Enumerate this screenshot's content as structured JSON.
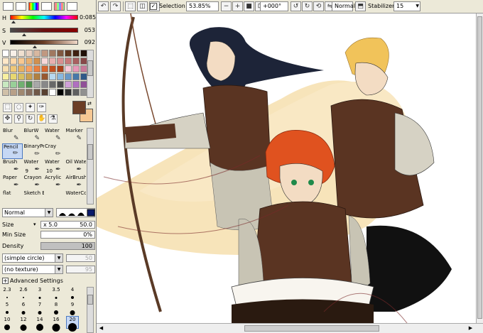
{
  "color_panel": {
    "h": {
      "label": "H",
      "value": "0:085",
      "fraction": 0.05
    },
    "s": {
      "label": "S",
      "value": "053",
      "fraction": 0.21
    },
    "v": {
      "label": "V",
      "value": "092",
      "fraction": 0.36
    },
    "main_color": "#6b3e26",
    "sub_color": "#f6c893"
  },
  "swatches": [
    "#ffffff",
    "#f8f0e8",
    "#f0e0d0",
    "#e8d0c0",
    "#d8b8a0",
    "#c09880",
    "#a07860",
    "#805840",
    "#603820",
    "#402010",
    "#201008",
    "#ffe8c8",
    "#ffd8a8",
    "#f8c890",
    "#e8b070",
    "#d09050",
    "#f8d8d8",
    "#e8b0b0",
    "#d89090",
    "#c87878",
    "#a86060",
    "#884848",
    "#f8e0b0",
    "#f0c878",
    "#e8b060",
    "#f8a060",
    "#e88040",
    "#d86830",
    "#c05020",
    "#a84018",
    "#f8c8d8",
    "#e898b8",
    "#c87898",
    "#f8f0a0",
    "#e8d870",
    "#d8c060",
    "#c8a050",
    "#b08040",
    "#985830",
    "#b8d8f0",
    "#88b8e0",
    "#6898c8",
    "#4878a8",
    "#305888",
    "#c8e8c0",
    "#98d098",
    "#70b070",
    "#509050",
    "#a8a8a8",
    "#888888",
    "#686868",
    "#484848",
    "#d0a0d8",
    "#b070c0",
    "#905098",
    "#d0c0a8",
    "#b8a088",
    "#a08870",
    "#887060",
    "#705848",
    "#584030",
    "#ffffff",
    "#000000",
    "#303030",
    "#606060",
    "#909090"
  ],
  "brushes": [
    {
      "name": "Blur",
      "icon": "✎"
    },
    {
      "name": "BlurW",
      "icon": "✎"
    },
    {
      "name": "Water",
      "icon": "✎"
    },
    {
      "name": "Marker",
      "icon": "✎"
    },
    {
      "name": "Pencil",
      "icon": "✏"
    },
    {
      "name": "BinaryPe",
      "icon": "✏"
    },
    {
      "name": "Cray",
      "icon": "✏"
    },
    {
      "name": "",
      "icon": ""
    },
    {
      "name": "Brush",
      "icon": "✒"
    },
    {
      "name": "Water",
      "num": "9",
      "icon": "✒"
    },
    {
      "name": "Water",
      "num": "10",
      "icon": "✒"
    },
    {
      "name": "Oil Wate",
      "icon": "✒"
    },
    {
      "name": "Paper",
      "icon": "✒"
    },
    {
      "name": "Crayon",
      "icon": "✒"
    },
    {
      "name": "Acrylic",
      "icon": "✒"
    },
    {
      "name": "AirBrush",
      "icon": "✒"
    },
    {
      "name": "flat",
      "icon": ""
    },
    {
      "name": "Sketch B",
      "icon": ""
    },
    {
      "name": "",
      "icon": ""
    },
    {
      "name": "WaterCc",
      "icon": ""
    }
  ],
  "brush_settings": {
    "blend_mode": "Normal",
    "size_label": "Size",
    "size_multiplier": "x 5.0",
    "size_value": "50.0",
    "min_size_label": "Min Size",
    "min_size_value": "0%",
    "density_label": "Density",
    "density_value": "100",
    "shape_combo": "(simple circle)",
    "shape_value": "50",
    "texture_combo": "(no texture)",
    "texture_value": "95",
    "advanced_label": "Advanced Settings"
  },
  "size_dots": [
    {
      "label": "2.3",
      "d": 2
    },
    {
      "label": "2.6",
      "d": 2
    },
    {
      "label": "3",
      "d": 3
    },
    {
      "label": "3.5",
      "d": 3
    },
    {
      "label": "4",
      "d": 4
    },
    {
      "label": "5",
      "d": 4
    },
    {
      "label": "6",
      "d": 5
    },
    {
      "label": "7",
      "d": 5
    },
    {
      "label": "8",
      "d": 6
    },
    {
      "label": "9",
      "d": 7
    },
    {
      "label": "10",
      "d": 8
    },
    {
      "label": "12",
      "d": 9
    },
    {
      "label": "14",
      "d": 10
    },
    {
      "label": "16",
      "d": 11
    },
    {
      "label": "20",
      "d": 12
    }
  ],
  "toolbar": {
    "selection_label": "Selection",
    "selection_checked": "✓",
    "zoom": "53.85%",
    "rotation": "+000°",
    "blend_mode": "Normal",
    "stabilizer_label": "Stabilizer",
    "stabilizer_value": "15"
  }
}
